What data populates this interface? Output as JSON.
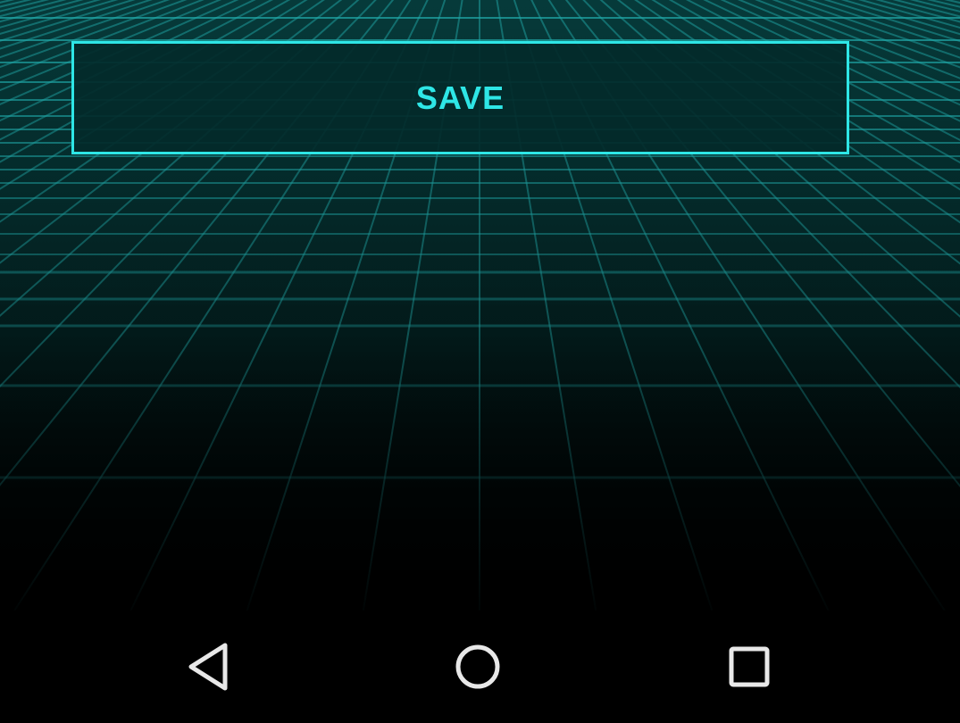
{
  "main": {
    "save_button_label": "SAVE",
    "accent_color": "#2ee6e6",
    "background": "perspective-grid"
  },
  "nav_bar": {
    "buttons": [
      {
        "icon": "back-triangle-icon"
      },
      {
        "icon": "home-circle-icon"
      },
      {
        "icon": "recents-square-icon"
      }
    ]
  }
}
